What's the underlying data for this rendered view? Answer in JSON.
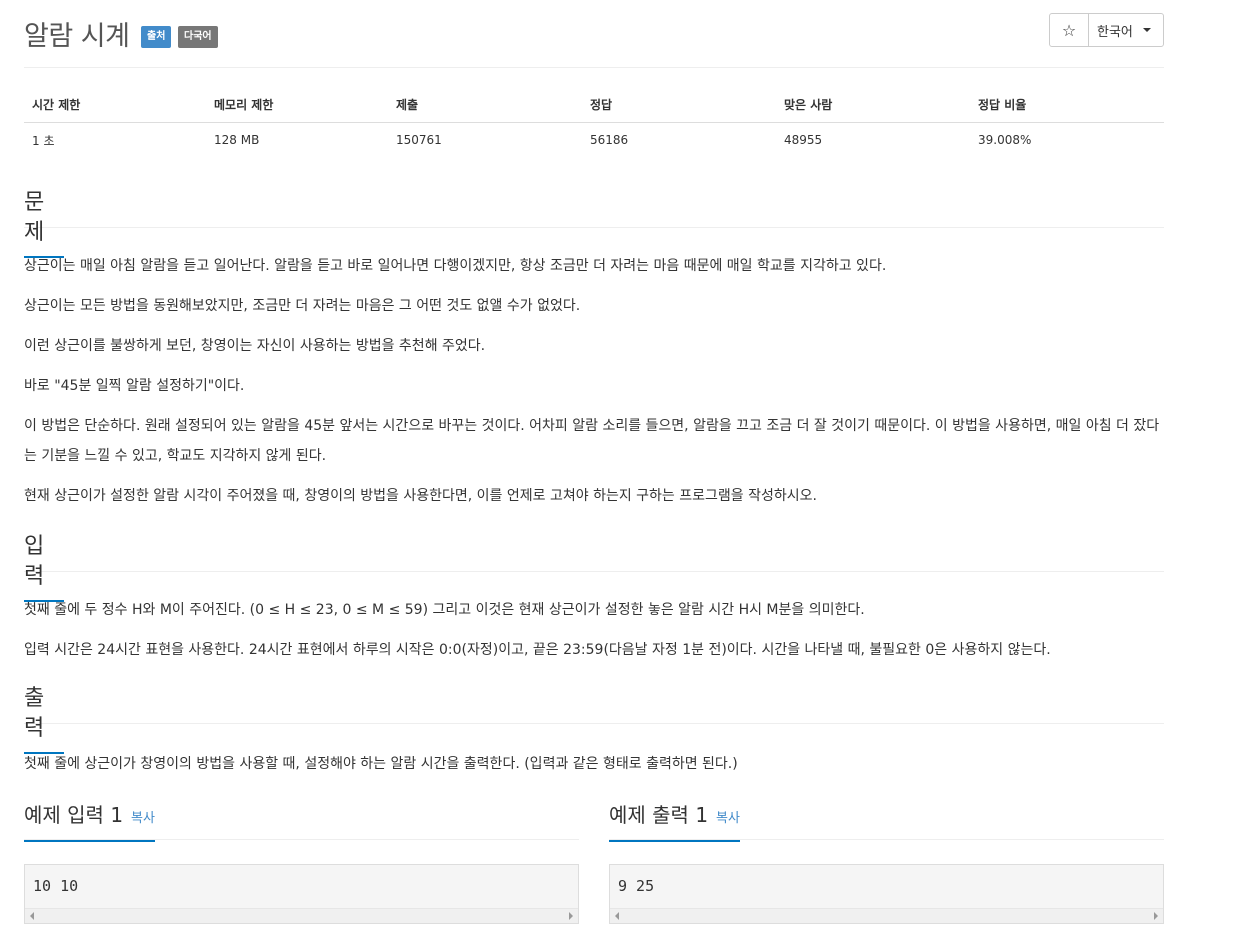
{
  "header": {
    "title": "알람 시계",
    "badge_source": "출처",
    "badge_multilang": "다국어",
    "star_icon": "☆",
    "language": "한국어"
  },
  "info_table": {
    "headers": [
      "시간 제한",
      "메모리 제한",
      "제출",
      "정답",
      "맞은 사람",
      "정답 비율"
    ],
    "values": [
      "1 초",
      "128 MB",
      "150761",
      "56186",
      "48955",
      "39.008%"
    ]
  },
  "problem": {
    "heading": "문제",
    "paragraphs": [
      "상근이는 매일 아침 알람을 듣고 일어난다. 알람을 듣고 바로 일어나면 다행이겠지만, 항상 조금만 더 자려는 마음 때문에 매일 학교를 지각하고 있다.",
      "상근이는 모든 방법을 동원해보았지만, 조금만 더 자려는 마음은 그 어떤 것도 없앨 수가 없었다.",
      "이런 상근이를 불쌍하게 보던, 창영이는 자신이 사용하는 방법을 추천해 주었다.",
      "바로 \"45분 일찍 알람 설정하기\"이다.",
      "이 방법은 단순하다. 원래 설정되어 있는 알람을 45분 앞서는 시간으로 바꾸는 것이다. 어차피 알람 소리를 들으면, 알람을 끄고 조금 더 잘 것이기 때문이다. 이 방법을 사용하면, 매일 아침 더 잤다는 기분을 느낄 수 있고, 학교도 지각하지 않게 된다.",
      "현재 상근이가 설정한 알람 시각이 주어졌을 때, 창영이의 방법을 사용한다면, 이를 언제로 고쳐야 하는지 구하는 프로그램을 작성하시오."
    ]
  },
  "input": {
    "heading": "입력",
    "paragraphs": [
      "첫째 줄에 두 정수 H와 M이 주어진다. (0 ≤ H ≤ 23, 0 ≤ M ≤ 59) 그리고 이것은 현재 상근이가 설정한 놓은 알람 시간 H시 M분을 의미한다.",
      "입력 시간은 24시간 표현을 사용한다. 24시간 표현에서 하루의 시작은 0:0(자정)이고, 끝은 23:59(다음날 자정 1분 전)이다. 시간을 나타낼 때, 불필요한 0은 사용하지 않는다."
    ]
  },
  "output": {
    "heading": "출력",
    "paragraphs": [
      "첫째 줄에 상근이가 창영이의 방법을 사용할 때, 설정해야 하는 알람 시간을 출력한다. (입력과 같은 형태로 출력하면 된다.)"
    ]
  },
  "samples": {
    "input_heading": "예제 입력 1",
    "output_heading": "예제 출력 1",
    "copy_label": "복사",
    "input_value": "10 10",
    "output_value": "9 25"
  }
}
